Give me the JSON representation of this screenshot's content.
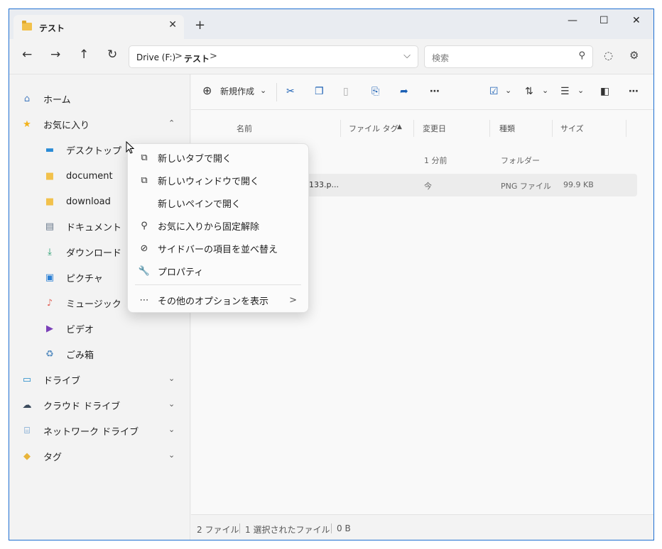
{
  "tab": {
    "title": "テスト",
    "close": "✕",
    "new": "+"
  },
  "window_controls": {
    "minimize": "—",
    "maximize": "☐",
    "close": "✕"
  },
  "nav": {
    "back": "←",
    "forward": "→",
    "up": "↑",
    "refresh": "↻"
  },
  "address": {
    "segments": [
      "Drive (F:)",
      "テスト"
    ],
    "separator": ">",
    "dropdown": "⌵"
  },
  "search": {
    "placeholder": "検索",
    "icon": "⚲"
  },
  "sidebar": {
    "items": [
      {
        "label": "ホーム",
        "icon": "home-icon",
        "glyph": "⌂",
        "color": "#4a7fc1",
        "indent": 0
      },
      {
        "label": "お気に入り",
        "icon": "star-icon",
        "glyph": "★",
        "color": "#f2b21b",
        "indent": 0,
        "expander": "⌃"
      },
      {
        "label": "デスクトップ",
        "icon": "desktop-icon",
        "glyph": "▬",
        "color": "#2a8bd6",
        "indent": 1
      },
      {
        "label": "document",
        "icon": "folder-icon",
        "glyph": "■",
        "color": "#f2c14b",
        "indent": 1
      },
      {
        "label": "download",
        "icon": "folder-icon",
        "glyph": "■",
        "color": "#f2c14b",
        "indent": 1
      },
      {
        "label": "ドキュメント",
        "icon": "document-icon",
        "glyph": "▤",
        "color": "#6a7a8c",
        "indent": 1
      },
      {
        "label": "ダウンロード",
        "icon": "download-icon",
        "glyph": "⤓",
        "color": "#1f9a6b",
        "indent": 1
      },
      {
        "label": "ピクチャ",
        "icon": "pictures-icon",
        "glyph": "▣",
        "color": "#2a7fd4",
        "indent": 1
      },
      {
        "label": "ミュージック",
        "icon": "music-icon",
        "glyph": "♪",
        "color": "#e0655b",
        "indent": 1
      },
      {
        "label": "ビデオ",
        "icon": "video-icon",
        "glyph": "▶",
        "color": "#7a3fb8",
        "indent": 1
      },
      {
        "label": "ごみ箱",
        "icon": "recycle-bin-icon",
        "glyph": "♻",
        "color": "#5a8fc1",
        "indent": 1
      },
      {
        "label": "ドライブ",
        "icon": "drive-icon",
        "glyph": "▭",
        "color": "#1e88c8",
        "indent": 0,
        "expander": "⌄"
      },
      {
        "label": "クラウド ドライブ",
        "icon": "cloud-drive-icon",
        "glyph": "☁",
        "color": "#3a4a5c",
        "indent": 0,
        "expander": "⌄"
      },
      {
        "label": "ネットワーク ドライブ",
        "icon": "network-drive-icon",
        "glyph": "⌸",
        "color": "#3a7fc0",
        "indent": 0,
        "expander": "⌄"
      },
      {
        "label": "タグ",
        "icon": "tag-icon",
        "glyph": "◆",
        "color": "#e8b43a",
        "indent": 0,
        "expander": "⌄"
      }
    ]
  },
  "toolbar": {
    "new_label": "新規作成",
    "new_glyph": "⊕",
    "chevron": "⌄",
    "cut": "✂",
    "copy": "❐",
    "paste": "▯",
    "rename": "⎘",
    "share": "➦",
    "more": "⋯",
    "select": "☑",
    "sort": "⇅",
    "view": "☰",
    "details": "◧"
  },
  "columns": {
    "name": "名前",
    "tag": "ファイル タグ",
    "tag_sort": "▲",
    "modified": "変更日",
    "type": "種類",
    "size": "サイズ"
  },
  "rows": [
    {
      "name": "",
      "modified": "1 分前",
      "type": "フォルダー",
      "size": ""
    },
    {
      "name": "133.p...",
      "modified": "今",
      "type": "PNG ファイル",
      "size": "99.9 KB"
    }
  ],
  "status": {
    "count": "2 ファイル",
    "selected": "1 選択されたファイル",
    "size": "0 B"
  },
  "context_menu": {
    "items": [
      {
        "label": "新しいタブで開く",
        "glyph": "⧉"
      },
      {
        "label": "新しいウィンドウで開く",
        "glyph": "⧉"
      },
      {
        "label": "新しいペインで開く",
        "glyph": ""
      },
      {
        "label": "お気に入りから固定解除",
        "glyph": "⚲"
      },
      {
        "label": "サイドバーの項目を並べ替え",
        "glyph": "⊘"
      },
      {
        "label": "プロパティ",
        "glyph": "🔧"
      },
      {
        "label": "その他のオプションを表示",
        "glyph": "⋯",
        "arrow": ">"
      }
    ]
  }
}
